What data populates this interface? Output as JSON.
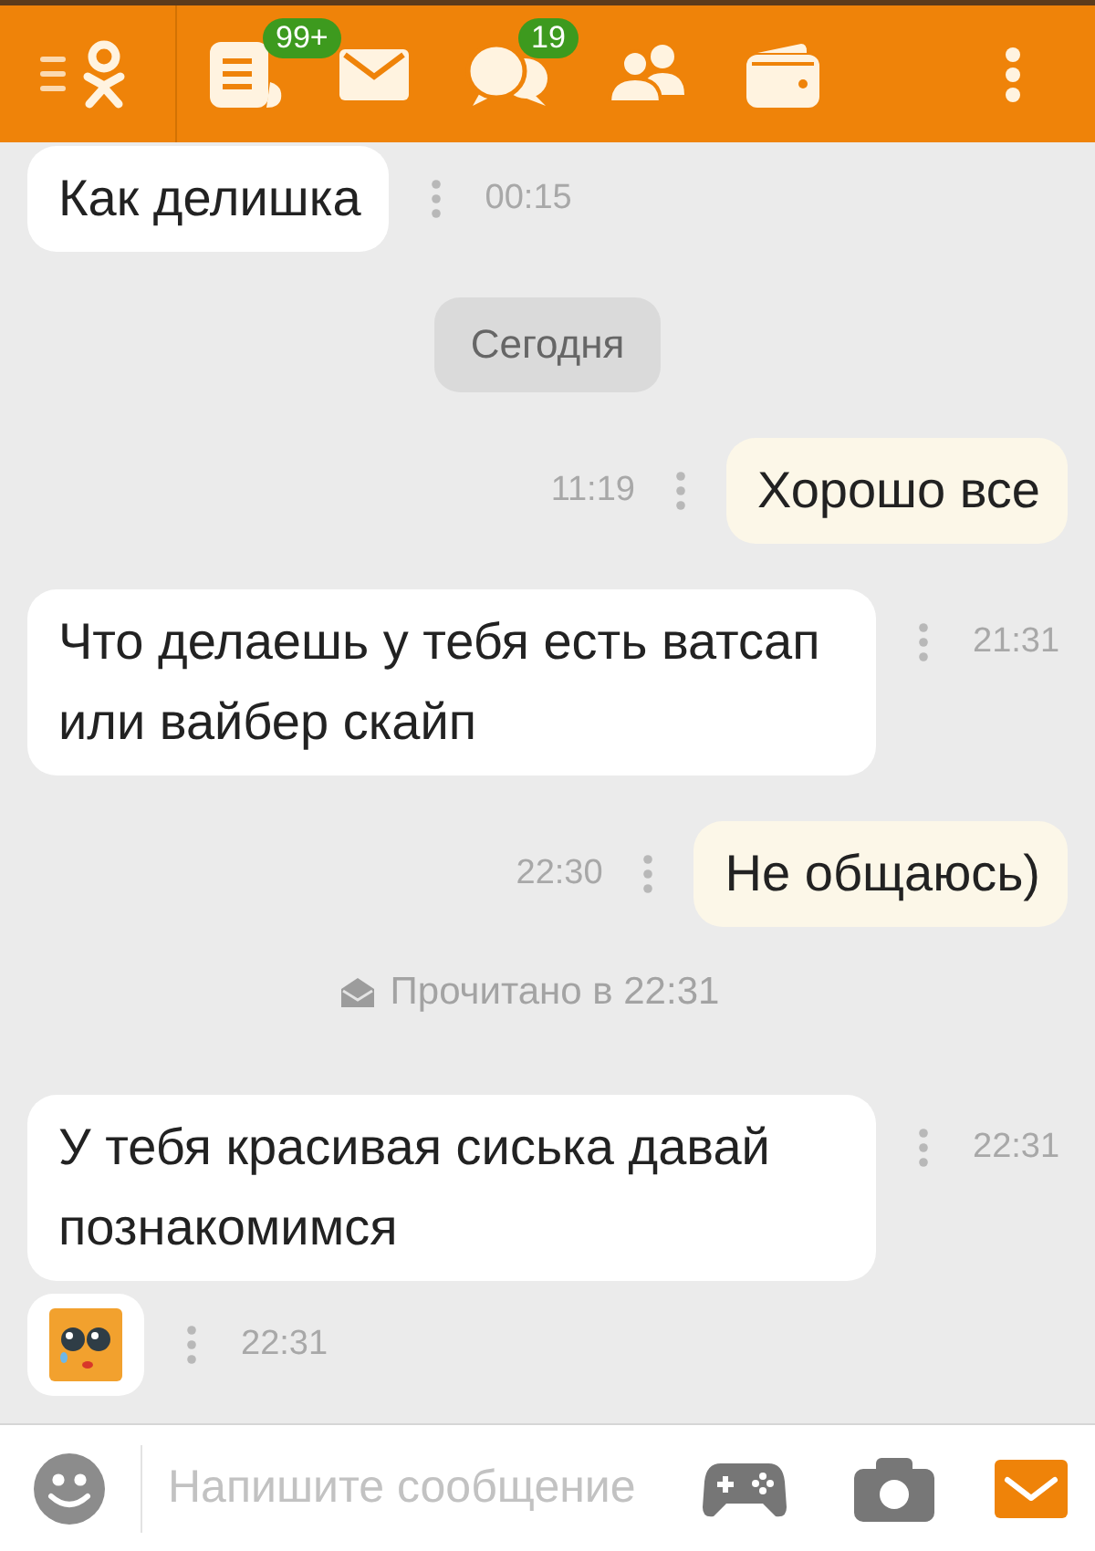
{
  "top_bar": {
    "feed_badge": "99+",
    "discussions_badge": "19"
  },
  "messages": [
    {
      "kind": "incoming",
      "text": "Как делишка",
      "time": "00:15"
    },
    {
      "kind": "date",
      "text": "Сегодня"
    },
    {
      "kind": "outgoing",
      "text": "Хорошо все",
      "time": "11:19"
    },
    {
      "kind": "incoming",
      "text": "Что делаешь у тебя есть ватсап или вайбер скайп",
      "time": "21:31"
    },
    {
      "kind": "outgoing",
      "text": "Не общаюсь)",
      "time": "22:30"
    },
    {
      "kind": "read_receipt",
      "text": "Прочитано в 22:31"
    },
    {
      "kind": "incoming",
      "text": "У тебя красивая сиська давай познакомимся",
      "time": "22:31"
    },
    {
      "kind": "sticker",
      "time": "22:31"
    }
  ],
  "composer": {
    "placeholder": "Напишите сообщение"
  }
}
